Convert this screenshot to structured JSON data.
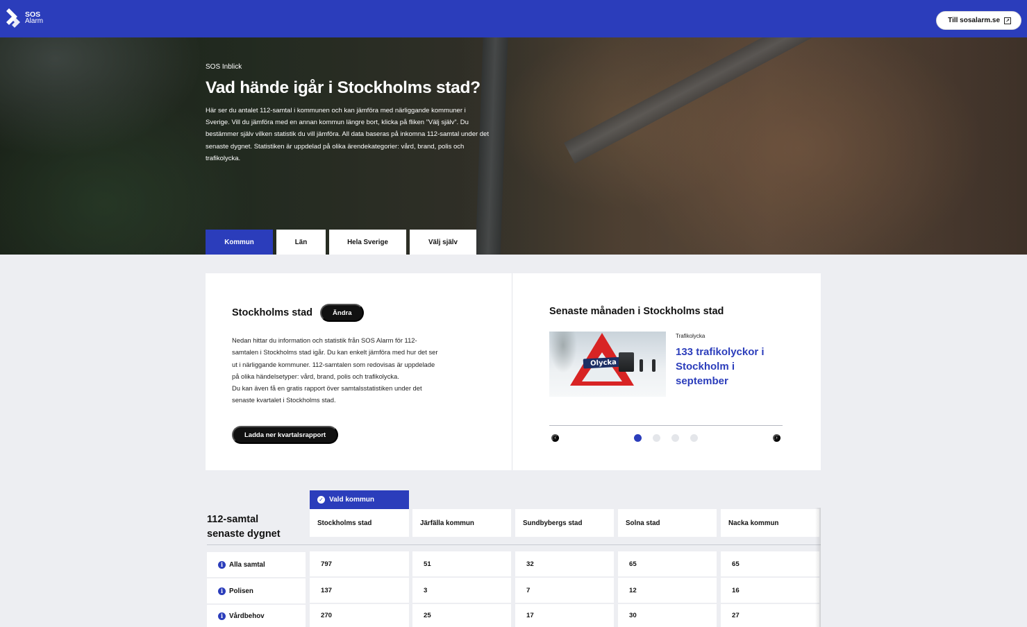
{
  "header": {
    "logo_line1": "SOS",
    "logo_line2": "Alarm",
    "external_link_label": "Till sosalarm.se",
    "external_icon": "external-link-icon",
    "brand_color": "#2b3dbb"
  },
  "hero": {
    "kicker": "SOS Inblick",
    "title": "Vad hände igår i Stockholms stad?",
    "description": "Här ser du antalet 112-samtal i kommunen och kan jämföra med närliggande kommuner i Sverige. Vill du jämföra med en annan kommun längre bort, klicka på fliken ”Välj själv”. Du bestämmer själv vilken statistik du vill jämföra. All data baseras på inkomna 112-samtal under det senaste dygnet. Statistiken är uppdelad på olika ärendekategorier: vård, brand, polis och trafikolycka."
  },
  "tabs": [
    {
      "label": "Kommun",
      "active": true
    },
    {
      "label": "Län",
      "active": false
    },
    {
      "label": "Hela Sverige",
      "active": false
    },
    {
      "label": "Välj själv",
      "active": false
    }
  ],
  "municipality": {
    "name": "Stockholms stad",
    "change_label": "Ändra",
    "description_1": "Nedan hittar du information och statistik från SOS Alarm för 112-samtalen i Stockholms stad igår. Du kan enkelt jämföra med hur det ser ut i närliggande kommuner. 112-samtalen som redovisas är uppdelade på olika händelsetyper: vård, brand, polis och trafikolycka.",
    "description_2": "Du kan även få en gratis rapport över samtalsstatistiken under det senaste kvartalet i Stockholms stad.",
    "download_label": "Ladda ner kvartalsrapport"
  },
  "month": {
    "title": "Senaste månaden i Stockholms stad",
    "news_category": "Trafikolycka",
    "news_headline": "133 trafikolyckor i Stockholm i september",
    "image_sign_text": "Olycka",
    "carousel_prev_icon": "chevron-left-icon",
    "carousel_next_icon": "chevron-right-icon",
    "dots_total": 4,
    "dot_active": 0
  },
  "table": {
    "selected_tag": "Vald kommun",
    "title_line1": "112-samtal",
    "title_line2": "senaste dygnet",
    "columns": [
      "Stockholms stad",
      "Järfälla kommun",
      "Sundbybergs stad",
      "Solna stad",
      "Nacka kommun"
    ],
    "rows": [
      {
        "label": "Alla samtal",
        "values": [
          "797",
          "51",
          "32",
          "65",
          "65"
        ]
      },
      {
        "label": "Polisen",
        "values": [
          "137",
          "3",
          "7",
          "12",
          "16"
        ]
      },
      {
        "label": "Vårdbehov",
        "values": [
          "270",
          "25",
          "17",
          "30",
          "27"
        ]
      }
    ],
    "info_icon": "info-icon"
  }
}
